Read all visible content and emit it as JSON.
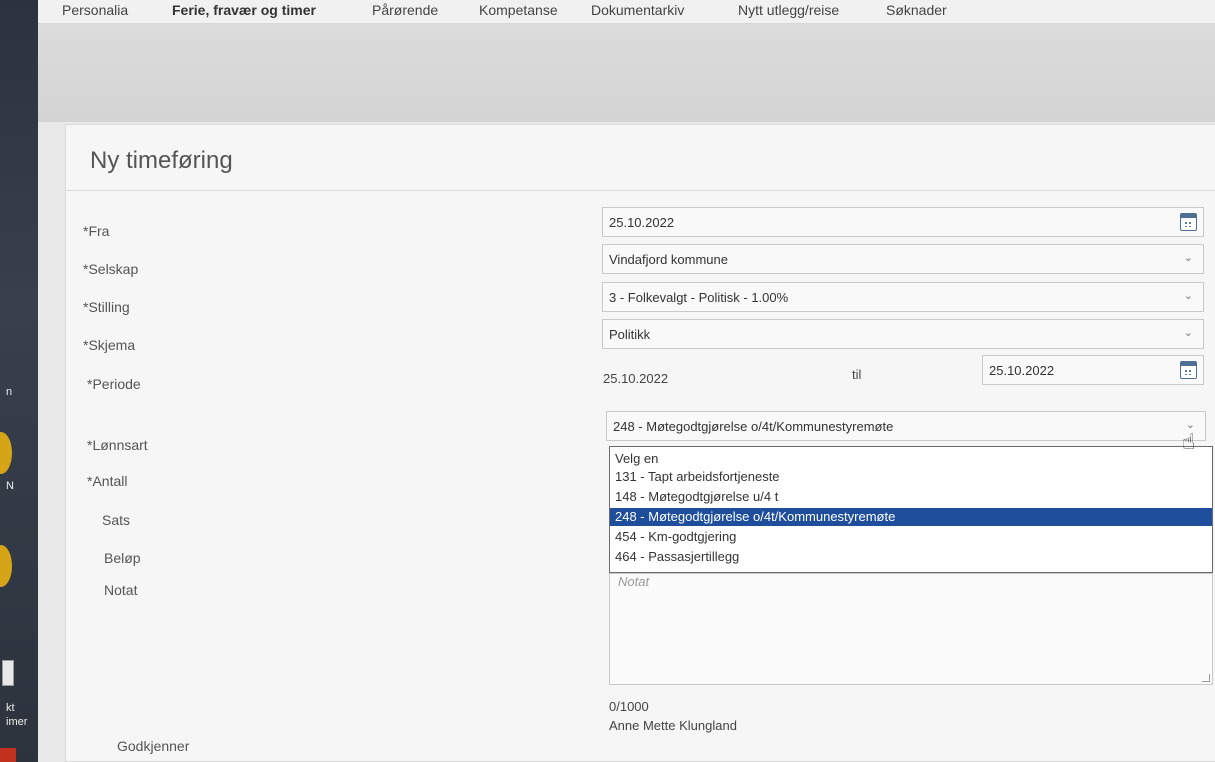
{
  "desktop": {
    "labels": [
      "n",
      "N",
      "kt",
      "imer"
    ]
  },
  "nav": {
    "tabs": [
      {
        "label": "Personalia",
        "active": false
      },
      {
        "label": "Ferie, fravær og timer",
        "active": true
      },
      {
        "label": "Pårørende",
        "active": false
      },
      {
        "label": "Kompetanse",
        "active": false
      },
      {
        "label": "Dokumentarkiv",
        "active": false
      },
      {
        "label": "Nytt utlegg/reise",
        "active": false
      },
      {
        "label": "Søknader",
        "active": false
      }
    ]
  },
  "form": {
    "title": "Ny timeføring",
    "fra": {
      "label": "*Fra",
      "value": "25.10.2022"
    },
    "selskap": {
      "label": "*Selskap",
      "value": "Vindafjord kommune"
    },
    "stilling": {
      "label": "*Stilling",
      "value": "3 - Folkevalgt - Politisk - 1.00%"
    },
    "skjema": {
      "label": "*Skjema",
      "value": "Politikk"
    },
    "periode": {
      "label": "*Periode",
      "from": "25.10.2022",
      "til_label": "til",
      "to": "25.10.2022"
    },
    "lonnsart": {
      "label": "*Lønnsart",
      "value": "248 - Møtegodtgjørelse o/4t/Kommunestyremøte",
      "options": [
        {
          "label": "Velg en",
          "selected": false
        },
        {
          "label": "131 - Tapt arbeidsfortjeneste",
          "selected": false
        },
        {
          "label": "148 - Møtegodtgjørelse u/4 t",
          "selected": false
        },
        {
          "label": "248 - Møtegodtgjørelse o/4t/Kommunestyremøte",
          "selected": true
        },
        {
          "label": "454 - Km-godtgjering",
          "selected": false
        },
        {
          "label": "464 - Passasjertillegg",
          "selected": false
        }
      ]
    },
    "antall": {
      "label": "*Antall"
    },
    "sats": {
      "label": "Sats"
    },
    "belop": {
      "label": "Beløp"
    },
    "notat": {
      "label": "Notat",
      "placeholder": "Notat",
      "counter": "0/1000"
    },
    "godkjenner": {
      "label": "Godkjenner",
      "value": "Anne Mette Klungland"
    }
  },
  "colors": {
    "selection": "#1f4e9c",
    "calendar_icon": "#4f6f94"
  }
}
